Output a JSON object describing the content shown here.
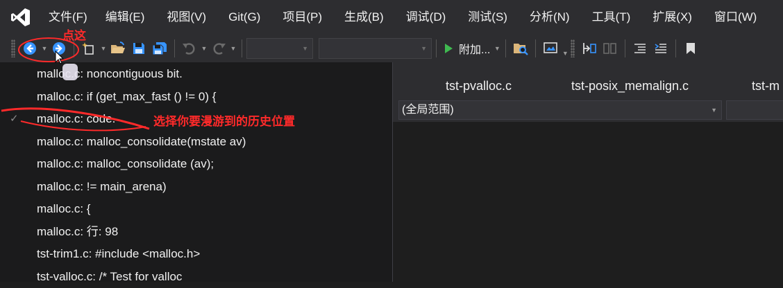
{
  "menu": {
    "items": [
      "文件(F)",
      "编辑(E)",
      "视图(V)",
      "Git(G)",
      "项目(P)",
      "生成(B)",
      "调试(D)",
      "测试(S)",
      "分析(N)",
      "工具(T)",
      "扩展(X)",
      "窗口(W)"
    ]
  },
  "toolbar": {
    "attach_label": "附加...",
    "icons": [
      "navigate-back-icon",
      "navigate-forward-icon",
      "new-project-icon",
      "open-file-icon",
      "save-icon",
      "save-all-icon",
      "undo-icon",
      "redo-icon",
      "start-icon",
      "find-in-files-icon"
    ]
  },
  "tabs": [
    "tst-pvalloc.c",
    "tst-posix_memalign.c",
    "tst-m"
  ],
  "scope": {
    "value": "(全局范围)"
  },
  "history": {
    "items": [
      "malloc.c: noncontiguous bit.",
      "malloc.c: if (get_max_fast () != 0) {",
      "malloc.c: code.",
      "malloc.c: malloc_consolidate(mstate av)",
      "malloc.c: malloc_consolidate (av);",
      "malloc.c: != main_arena)",
      "malloc.c: {",
      "malloc.c: 行: 98",
      "tst-trim1.c: #include <malloc.h>",
      "tst-valloc.c: /* Test for valloc"
    ],
    "current_index": 2,
    "check_mark": "✓"
  },
  "annotations": {
    "click_here": "点这",
    "select_history": "选择你要漫游到的历史位置"
  },
  "colors": {
    "background": "#1e1e1e",
    "chrome": "#2d2d30",
    "accent_blue": "#3794ff",
    "annotation_red": "#ff2a2a",
    "play_green": "#3fb950"
  }
}
